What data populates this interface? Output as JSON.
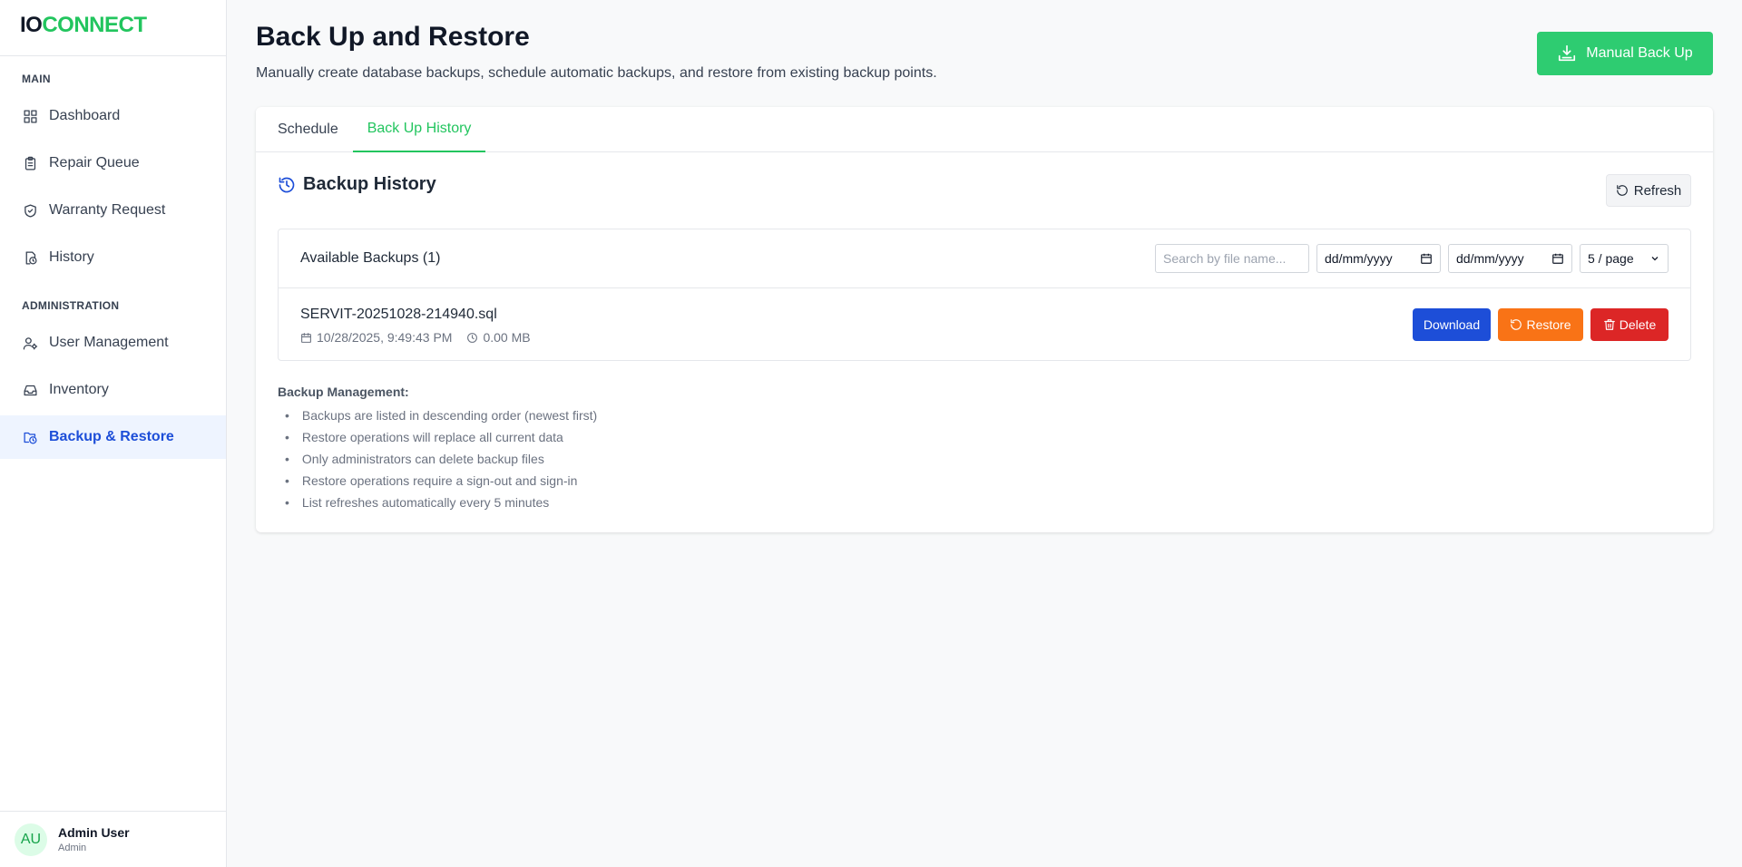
{
  "logo": {
    "part1": "IO",
    "part2": "CONNECT"
  },
  "sidebar": {
    "sections": [
      {
        "title": "MAIN"
      },
      {
        "title": "ADMINISTRATION"
      }
    ],
    "items": [
      {
        "label": "Dashboard",
        "icon": "grid-icon"
      },
      {
        "label": "Repair Queue",
        "icon": "clipboard-icon"
      },
      {
        "label": "Warranty Request",
        "icon": "shield-check-icon"
      },
      {
        "label": "History",
        "icon": "history-icon"
      },
      {
        "label": "User Management",
        "icon": "user-cog-icon"
      },
      {
        "label": "Inventory",
        "icon": "inbox-icon"
      },
      {
        "label": "Backup & Restore",
        "icon": "folder-clock-icon",
        "active": true
      }
    ],
    "user": {
      "initials": "AU",
      "name": "Admin User",
      "role": "Admin"
    }
  },
  "header": {
    "title": "Back Up and Restore",
    "subtitle": "Manually create database backups, schedule automatic backups, and restore from existing backup points.",
    "manual_backup_label": "Manual Back Up"
  },
  "tabs": [
    {
      "label": "Schedule"
    },
    {
      "label": "Back Up History",
      "active": true
    }
  ],
  "history": {
    "title": "Backup History",
    "refresh_label": "Refresh",
    "available_label": "Available Backups (1)",
    "search_placeholder": "Search by file name...",
    "date_from": "dd/mm/yyyy",
    "date_to": "dd/mm/yyyy",
    "page_size": "5 / page",
    "backups": [
      {
        "file": "SERVIT-20251028-214940.sql",
        "datetime": "10/28/2025, 9:49:43 PM",
        "size": "0.00 MB"
      }
    ],
    "actions": {
      "download": "Download",
      "restore": "Restore",
      "delete": "Delete"
    }
  },
  "management": {
    "title": "Backup Management:",
    "notes": [
      "Backups are listed in descending order (newest first)",
      "Restore operations will replace all current data",
      "Only administrators can delete backup files",
      "Restore operations require a sign-out and sign-in",
      "List refreshes automatically every 5 minutes"
    ]
  },
  "colors": {
    "accent_green": "#22c55e",
    "manual_button": "#2ecc71",
    "download": "#1d4ed8",
    "restore": "#f97316",
    "delete": "#dc2626"
  }
}
